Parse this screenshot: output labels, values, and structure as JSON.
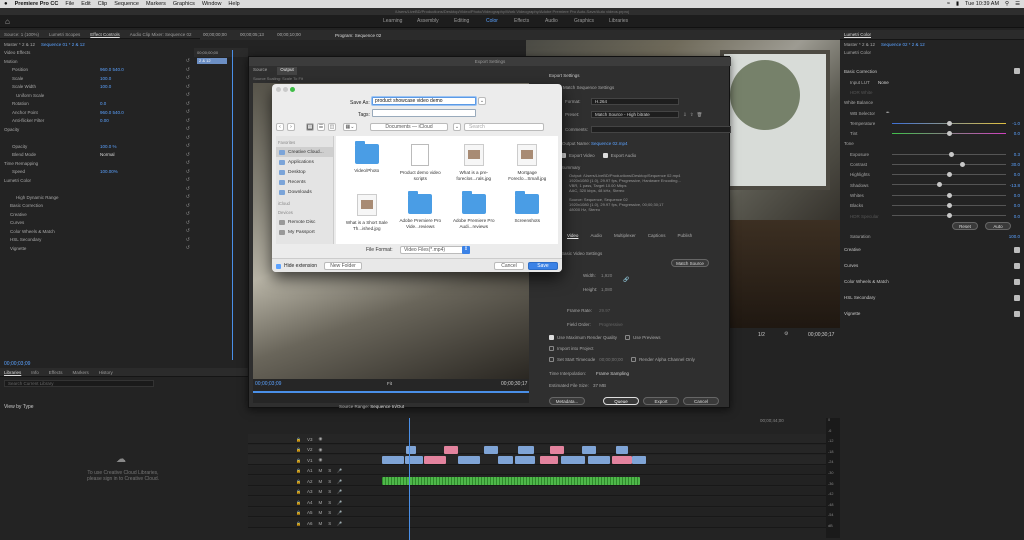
{
  "menubar": {
    "apple": "",
    "app_name": "Premiere Pro CC",
    "items": [
      "File",
      "Edit",
      "Clip",
      "Sequence",
      "Markers",
      "Graphics",
      "Window",
      "Help"
    ],
    "clock": "Tue 10:39 AM"
  },
  "titlebar": {
    "path": "/Users/LiveBD/Productions/Desktop/Video/Photo/Videography/Work Videography/Adobe Premiere Pro Auto-Save/Auto videos.prproj"
  },
  "workspaces": [
    "Learning",
    "Assembly",
    "Editing",
    "Color",
    "Effects",
    "Audio",
    "Graphics",
    "Libraries"
  ],
  "workspace_active": "Color",
  "left_panel": {
    "tabs": [
      "Source: 1 (100%)",
      "Lumetri Scopes",
      "Effect Controls",
      "Audio Clip Mixer: Sequence 02"
    ],
    "active_tab": "Effect Controls",
    "master": "Master * 2 & 12",
    "sequence": "Sequence 01 * 2 & 12",
    "timecode": "00;00;00;00",
    "timecode2": "00;00;05;13",
    "timecode3": "00;00;10;00",
    "clip_label": "2 & 12",
    "video_effects": "Video Effects",
    "rows": [
      {
        "name": "Motion",
        "value": ""
      },
      {
        "name": "Position",
        "value": "960.0    540.0"
      },
      {
        "name": "Scale",
        "value": "100.0"
      },
      {
        "name": "Scale Width",
        "value": "100.0"
      },
      {
        "name": "Uniform Scale",
        "value": ""
      },
      {
        "name": "Rotation",
        "value": "0.0"
      },
      {
        "name": "Anchor Point",
        "value": "960.0    540.0"
      },
      {
        "name": "Anti-flicker Filter",
        "value": "0.00"
      },
      {
        "name": "Opacity",
        "value": ""
      },
      {
        "name": "",
        "value": ""
      },
      {
        "name": "Opacity",
        "value": "100.0 %"
      },
      {
        "name": "Blend Mode",
        "value": "Normal"
      },
      {
        "name": "Time Remapping",
        "value": ""
      },
      {
        "name": "Speed",
        "value": "100.00%"
      },
      {
        "name": "Lumetri Color",
        "value": ""
      },
      {
        "name": "",
        "value": ""
      },
      {
        "name": "High Dynamic Range",
        "value": ""
      },
      {
        "name": "Basic Correction",
        "value": ""
      },
      {
        "name": "Creative",
        "value": ""
      },
      {
        "name": "Curves",
        "value": ""
      },
      {
        "name": "Color Wheels & Match",
        "value": ""
      },
      {
        "name": "HSL Secondary",
        "value": ""
      },
      {
        "name": "Vignette",
        "value": ""
      }
    ],
    "bottom_timecode": "00;00;03;09"
  },
  "libraries": {
    "tabs": [
      "Libraries",
      "Info",
      "Effects",
      "Markers",
      "History"
    ],
    "search_placeholder": "Search Current Library",
    "view_by": "View by Type",
    "message_line1": "To use Creative Cloud Libraries,",
    "message_line2": "please sign in to Creative Cloud."
  },
  "program": {
    "header": "Program: Sequence 02",
    "timecode": "00;00;30;17",
    "zoom": "1/2"
  },
  "lumetri": {
    "title": "Lumetri Color",
    "master": "Master * 2 & 12",
    "sequence": "Sequence 02 * 2 & 12",
    "fx": "Lumetri Color",
    "basic_correction": "Basic Correction",
    "input_lut_label": "Input LUT",
    "input_lut_value": "None",
    "hdr_white": "HDR White",
    "white_balance": "White Balance",
    "wb_selector": "WB Selector",
    "tone": "Tone",
    "rows": [
      {
        "name": "Temperature",
        "value": "-1.0"
      },
      {
        "name": "Tint",
        "value": "0.0"
      },
      {
        "name": "Exposure",
        "value": "0.3"
      },
      {
        "name": "Contrast",
        "value": "30.0"
      },
      {
        "name": "Highlights",
        "value": "0.0"
      },
      {
        "name": "Shadows",
        "value": "-13.8"
      },
      {
        "name": "Whites",
        "value": "0.0"
      },
      {
        "name": "Blacks",
        "value": "0.0"
      },
      {
        "name": "HDR Specular",
        "value": "0.0"
      }
    ],
    "reset": "Reset",
    "auto": "Auto",
    "saturation_label": "Saturation",
    "saturation_value": "100.0",
    "sections": [
      "Creative",
      "Curves",
      "Color Wheels & Match",
      "HSL Secondary",
      "Vignette"
    ]
  },
  "export": {
    "title": "Export Settings",
    "tabs": [
      "Source",
      "Output"
    ],
    "active_tab": "Output",
    "source_scaling": "Source Scaling:",
    "source_scaling_value": "Scale To Fit",
    "section": "Export Settings",
    "match_sequence": "Match Sequence Settings",
    "format_label": "Format:",
    "format_value": "H.264",
    "preset_label": "Preset:",
    "preset_value": "Match Source - High bitrate",
    "comments_label": "Comments:",
    "output_name_label": "Output Name:",
    "output_name_value": "Sequence 02.mp4",
    "export_video": "Export Video",
    "export_audio": "Export Audio",
    "summary": "Summary",
    "summary_output": "Output: /Users/LiveBD/Productions/Desktop/Sequence 02.mp4\n1920x1080 (1.0), 29.97 fps, Progressive, Hardware Encoding...\nVBR, 1 pass, Target 10.00 Mbps\nAAC, 320 kbps, 48 kHz, Stereo",
    "summary_source": "Source: Sequence, Sequence 02\n1920x1080 (1.0), 29.97 fps, Progressive, 00;00;30;17\n48000 Hz, Stereo",
    "sub_tabs": [
      "Video",
      "Audio",
      "Multiplexer",
      "Captions",
      "Publish"
    ],
    "active_sub_tab": "Video",
    "basic_video": "Basic Video Settings",
    "match_source_btn": "Match Source",
    "width_label": "Width:",
    "width_value": "1,920",
    "height_label": "Height:",
    "height_value": "1,080",
    "frame_rate_label": "Frame Rate:",
    "frame_rate_value": "29.97",
    "field_order_label": "Field Order:",
    "field_order_value": "Progressive",
    "use_max_quality": "Use Maximum Render Quality",
    "use_previews": "Use Previews",
    "import_project": "Import into Project",
    "set_start_tc": "Set Start Timecode",
    "start_tc_value": "00;00;00;00",
    "render_alpha": "Render Alpha Channel Only",
    "time_interp_label": "Time Interpolation:",
    "time_interp_value": "Frame Sampling",
    "est_size_label": "Estimated File Size:",
    "est_size_value": "37 MB",
    "btn_metadata": "Metadata...",
    "btn_queue": "Queue",
    "btn_export": "Export",
    "btn_cancel": "Cancel",
    "source_range_label": "Source Range:",
    "source_range_value": "Sequence In/Out",
    "tc_left": "00;00;03;09",
    "tc_right": "00;00;30;17",
    "fit": "Fit"
  },
  "save_dialog": {
    "save_as_label": "Save As:",
    "save_as_value": "product showcase video demo",
    "tags_label": "Tags:",
    "location": "Documents — iCloud",
    "search_placeholder": "Search",
    "favorites": "Favorites",
    "sidebar": [
      "Creative Cloud...",
      "Applications",
      "Desktop",
      "Recents",
      "Downloads"
    ],
    "icloud": "iCloud",
    "devices": "Devices",
    "devices_items": [
      "Remote Disc",
      "My Passport"
    ],
    "files": [
      {
        "name": "Video/Photo",
        "kind": "folder"
      },
      {
        "name": "Product demo video scripts",
        "kind": "doc"
      },
      {
        "name": "What is a pre-foreclos...rals.jpg",
        "kind": "thumb"
      },
      {
        "name": "Mortgage Foreclo...Small.jpg",
        "kind": "thumb"
      },
      {
        "name": "What is a Short Sale Th...ished.jpg",
        "kind": "thumb"
      },
      {
        "name": "Adobe Premiere Pro Vide...reviews",
        "kind": "folder"
      },
      {
        "name": "Adobe Premiere Pro Audi...reviews",
        "kind": "folder"
      },
      {
        "name": "Screenshots",
        "kind": "folder"
      }
    ],
    "file_format_label": "File Format:",
    "file_format_value": "Video Files(*.mp4)",
    "hide_extension": "Hide extension",
    "new_folder": "New Folder",
    "cancel": "Cancel",
    "save": "Save"
  },
  "timeline": {
    "tracks": [
      "V3",
      "V2",
      "V1",
      "A1",
      "A2",
      "A3",
      "A4",
      "A5",
      "A6"
    ],
    "track_buttons": [
      "M",
      "S"
    ],
    "meter_ticks": [
      "0",
      "-6",
      "-12",
      "-18",
      "-24",
      "-30",
      "-36",
      "-42",
      "-48",
      "-54",
      "dB"
    ],
    "tc": "00;00;44;00"
  }
}
